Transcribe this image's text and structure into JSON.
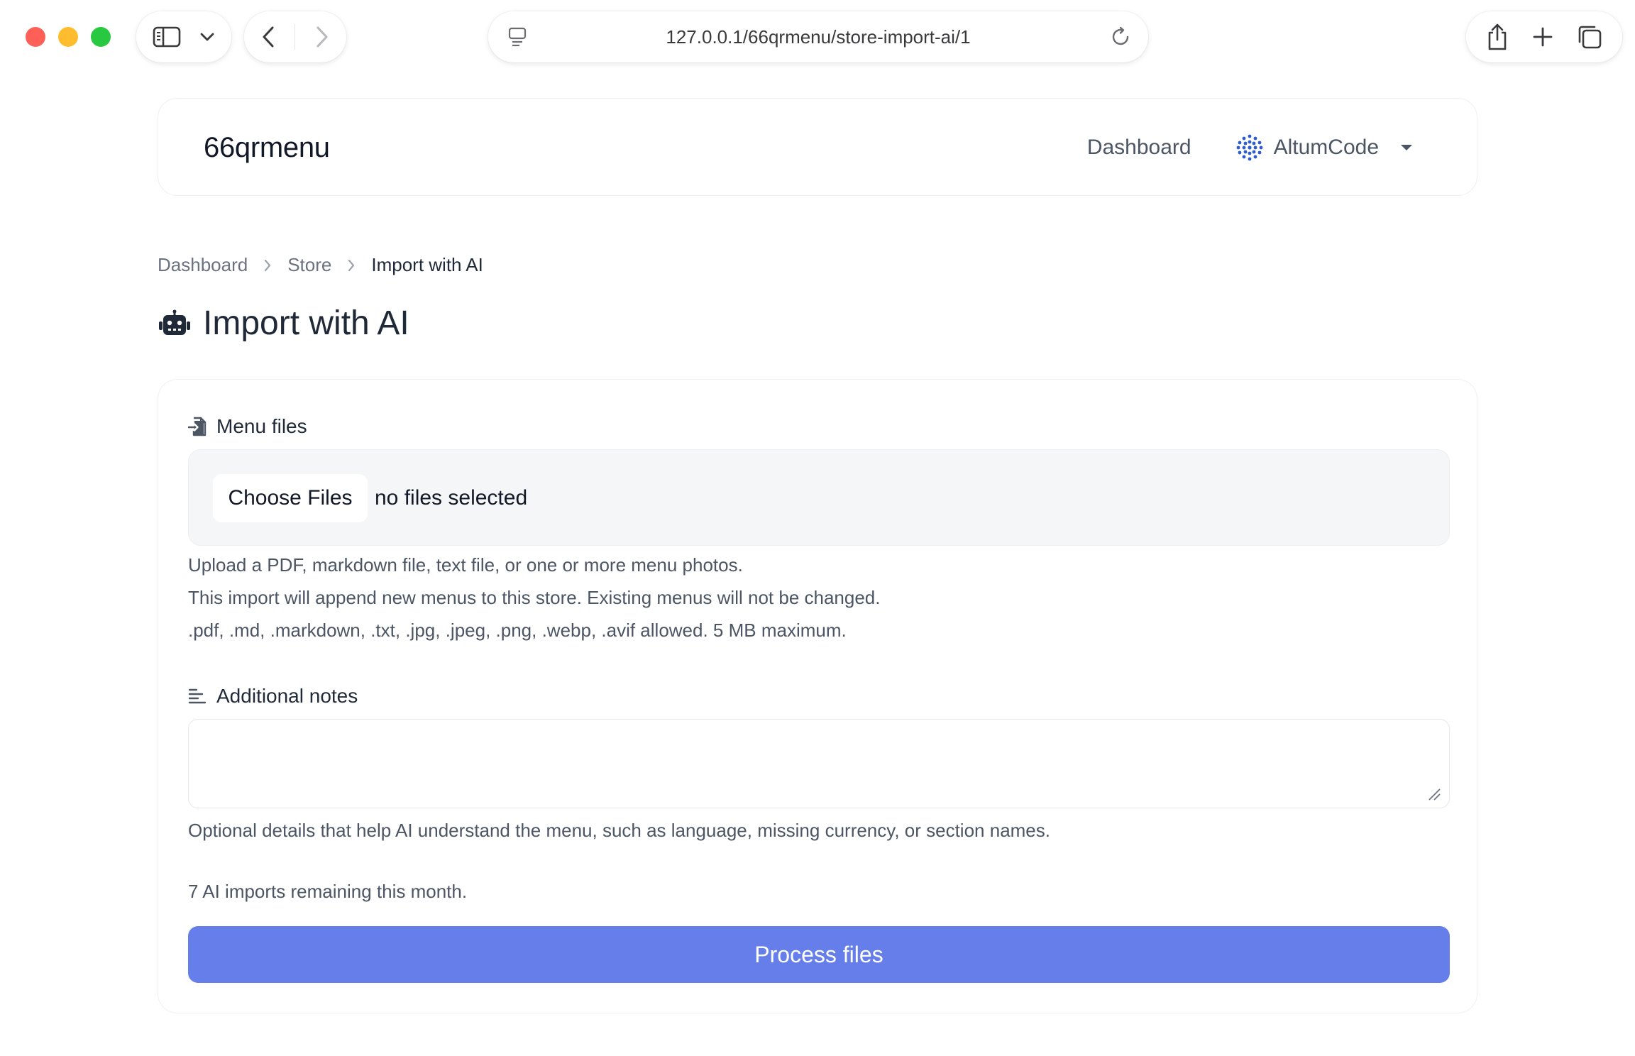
{
  "browser": {
    "url": "127.0.0.1/66qrmenu/store-import-ai/1"
  },
  "navbar": {
    "brand": "66qrmenu",
    "dashboard_link": "Dashboard",
    "account_name": "AltumCode"
  },
  "breadcrumb": {
    "items": [
      "Dashboard",
      "Store",
      "Import with AI"
    ]
  },
  "page": {
    "title": "Import with AI"
  },
  "form": {
    "menu_files": {
      "label": "Menu files",
      "choose_button": "Choose Files",
      "status": "no files selected",
      "help_lines": [
        "Upload a PDF, markdown file, text file, or one or more menu photos.",
        "This import will append new menus to this store. Existing menus will not be changed.",
        ".pdf, .md, .markdown, .txt, .jpg, .jpeg, .png, .webp, .avif allowed. 5 MB maximum."
      ]
    },
    "notes": {
      "label": "Additional notes",
      "value": "",
      "help": "Optional details that help AI understand the menu, such as language, missing currency, or section names."
    },
    "remaining": "7 AI imports remaining this month.",
    "submit_label": "Process files"
  },
  "colors": {
    "primary": "#667eea",
    "traffic_red": "#fe5f57",
    "traffic_yellow": "#febc2e",
    "traffic_green": "#28c840"
  }
}
